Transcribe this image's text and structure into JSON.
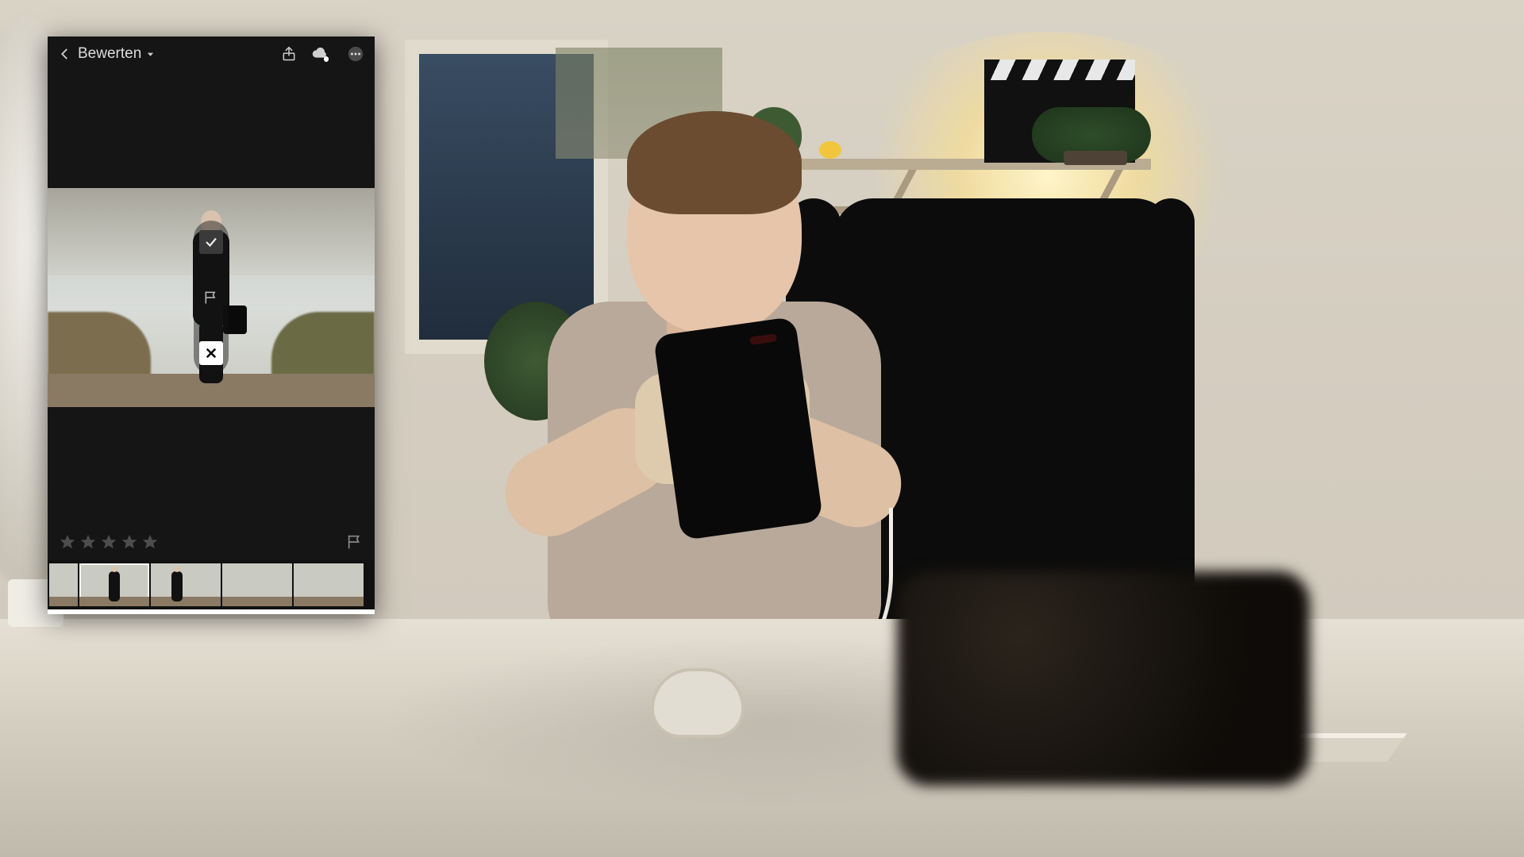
{
  "topbar": {
    "mode_label": "Bewerten",
    "icons": {
      "back": "chevron-left",
      "share": "share",
      "cloud": "cloud-sync",
      "more": "ellipsis"
    }
  },
  "flag_popover": {
    "pick": "check",
    "unflag": "flag-outline",
    "reject": "x",
    "selected": "reject"
  },
  "rating": {
    "stars_filled": 0,
    "stars_total": 5
  },
  "filmstrip": {
    "selected_index": 1,
    "thumbs": [
      {
        "id": 0,
        "kind": "partial"
      },
      {
        "id": 1,
        "kind": "person-front"
      },
      {
        "id": 2,
        "kind": "person-side"
      },
      {
        "id": 3,
        "kind": "landscape"
      },
      {
        "id": 4,
        "kind": "landscape"
      }
    ]
  }
}
